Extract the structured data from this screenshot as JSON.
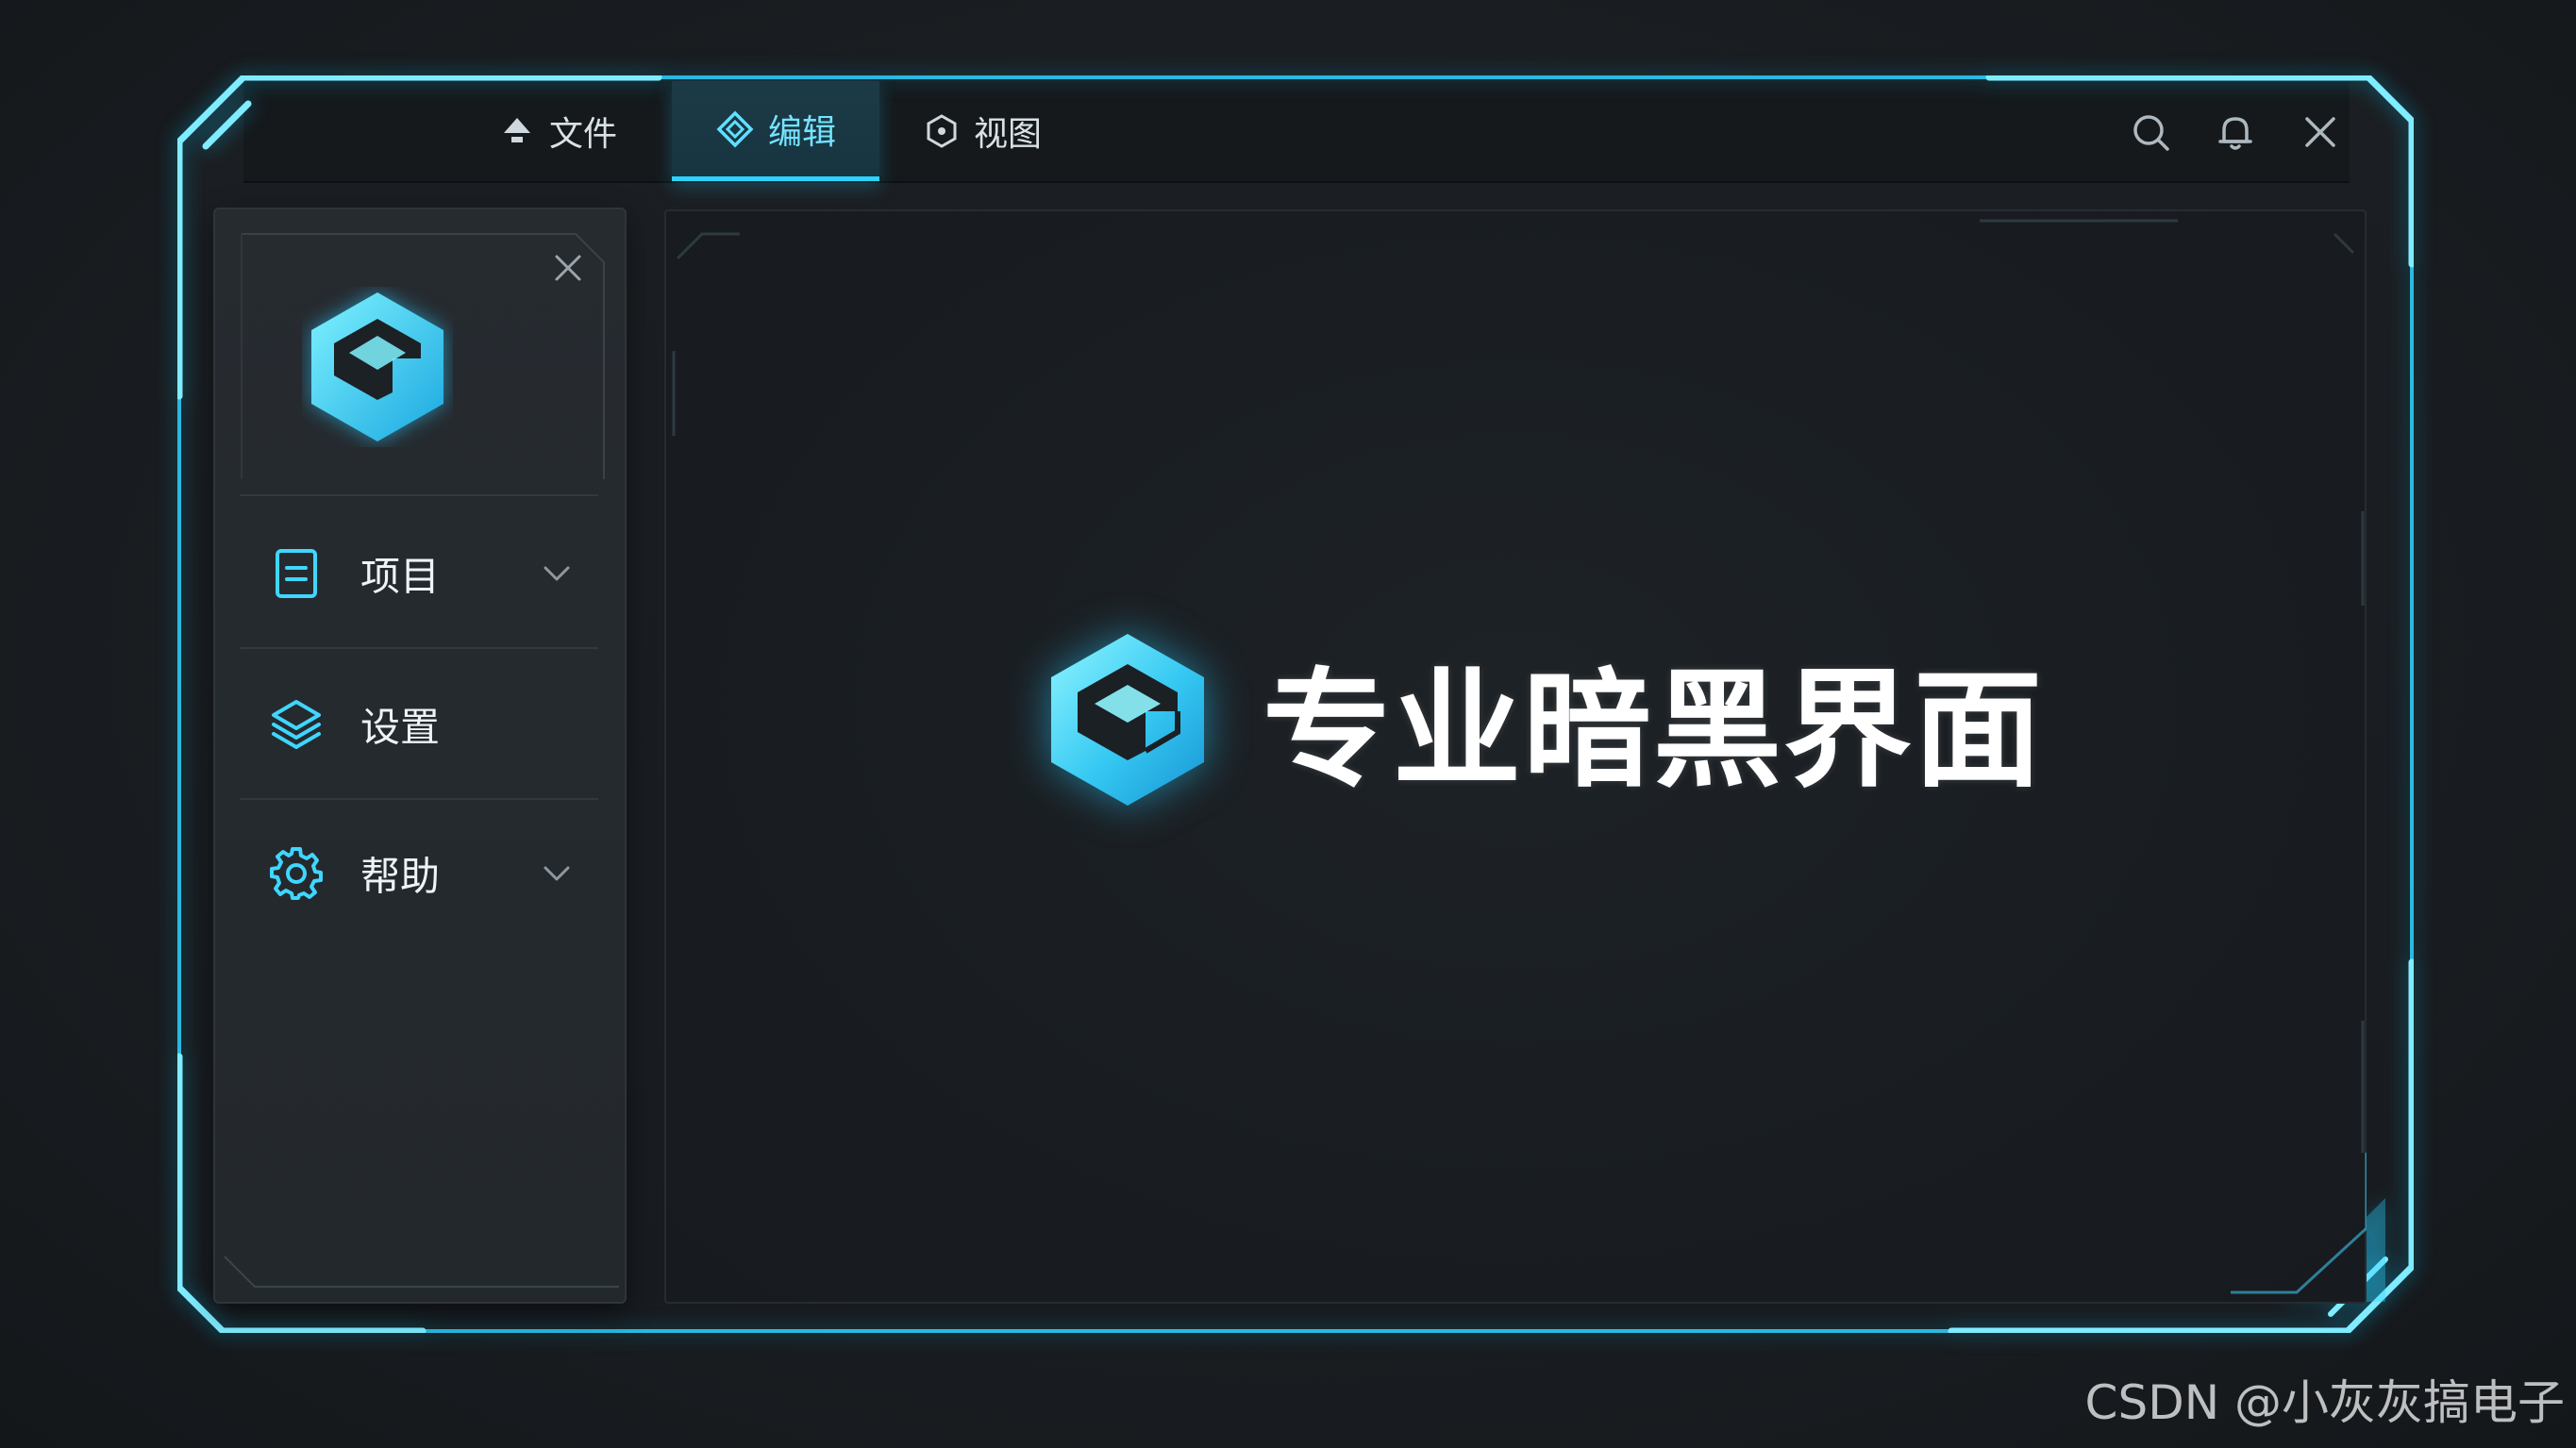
{
  "tabs": [
    {
      "label": "文件",
      "icon": "upload-arrow-icon",
      "active": false
    },
    {
      "label": "编辑",
      "icon": "diamond-layers-icon",
      "active": true
    },
    {
      "label": "视图",
      "icon": "hexagon-eye-icon",
      "active": false
    }
  ],
  "top_icons": [
    "search-icon",
    "bell-icon",
    "close-icon"
  ],
  "sidebar": {
    "close_icon": "close-icon",
    "logo_icon": "hex-cube-logo-icon",
    "items": [
      {
        "label": "项目",
        "icon": "document-icon",
        "has_chevron": true
      },
      {
        "label": "设置",
        "icon": "layers-icon",
        "has_chevron": false
      },
      {
        "label": "帮助",
        "icon": "gear-icon",
        "has_chevron": true
      }
    ]
  },
  "main": {
    "logo_icon": "hex-cube-logo-icon",
    "title": "专业暗黑界面"
  },
  "watermark": "CSDN @小灰灰搞电子",
  "colors": {
    "accent": "#2fd2ff",
    "accent_glow": "#00c8ff",
    "background": "#181c20",
    "panel": "#23282c",
    "text": "#eef3f6"
  }
}
